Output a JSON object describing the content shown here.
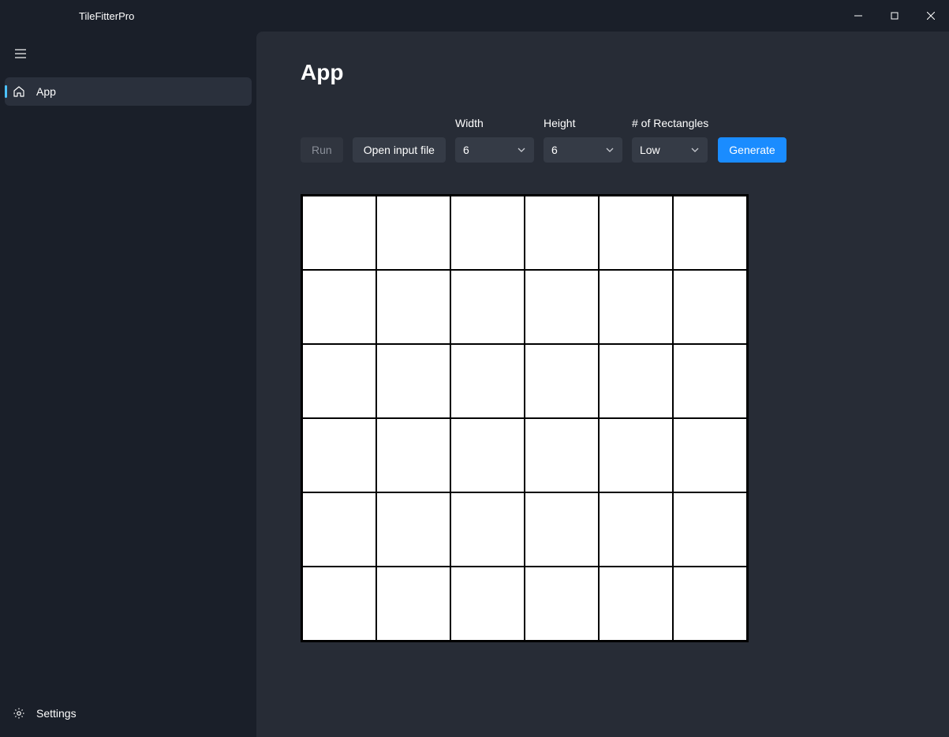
{
  "window": {
    "title": "TileFitterPro"
  },
  "sidebar": {
    "items": [
      {
        "label": "App",
        "icon": "home"
      }
    ],
    "settings_label": "Settings"
  },
  "page": {
    "title": "App"
  },
  "toolbar": {
    "run_label": "Run",
    "open_label": "Open input file",
    "width_label": "Width",
    "height_label": "Height",
    "rects_label": "# of Rectangles",
    "generate_label": "Generate",
    "width_value": "6",
    "height_value": "6",
    "rects_value": "Low"
  },
  "grid": {
    "rows": 6,
    "cols": 6
  }
}
